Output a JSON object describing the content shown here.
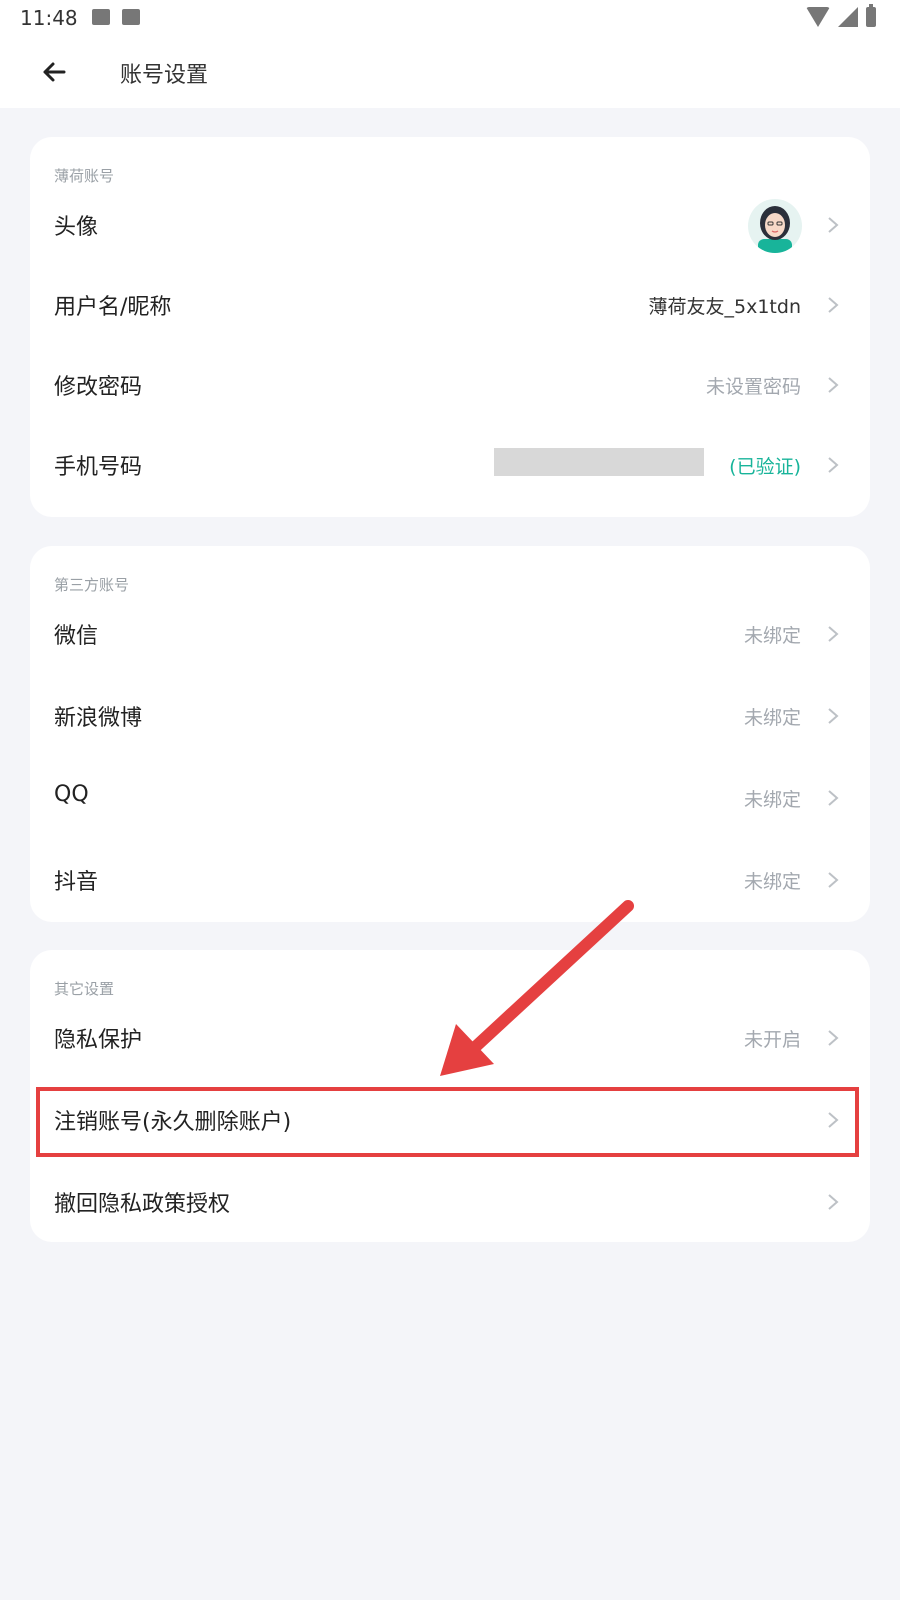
{
  "status_bar": {
    "time": "11:48"
  },
  "app_bar": {
    "title": "账号设置"
  },
  "section_account": {
    "header": "薄荷账号",
    "rows": [
      {
        "label": "头像",
        "value": ""
      },
      {
        "label": "用户名/昵称",
        "value": "薄荷友友_5x1tdn"
      },
      {
        "label": "修改密码",
        "value": "未设置密码"
      },
      {
        "label": "手机号码",
        "value": "(已验证)"
      }
    ]
  },
  "section_third_party": {
    "header": "第三方账号",
    "rows": [
      {
        "label": "微信",
        "value": "未绑定"
      },
      {
        "label": "新浪微博",
        "value": "未绑定"
      },
      {
        "label": "QQ",
        "value": "未绑定"
      },
      {
        "label": "抖音",
        "value": "未绑定"
      }
    ]
  },
  "section_other": {
    "header": "其它设置",
    "rows": [
      {
        "label": "隐私保护",
        "value": "未开启"
      },
      {
        "label": "注销账号(永久删除账户)",
        "value": ""
      },
      {
        "label": "撤回隐私政策授权",
        "value": ""
      }
    ]
  },
  "colors": {
    "accent_green": "#18b49a",
    "annotation_red": "#e54040",
    "background": "#f4f5f9"
  }
}
